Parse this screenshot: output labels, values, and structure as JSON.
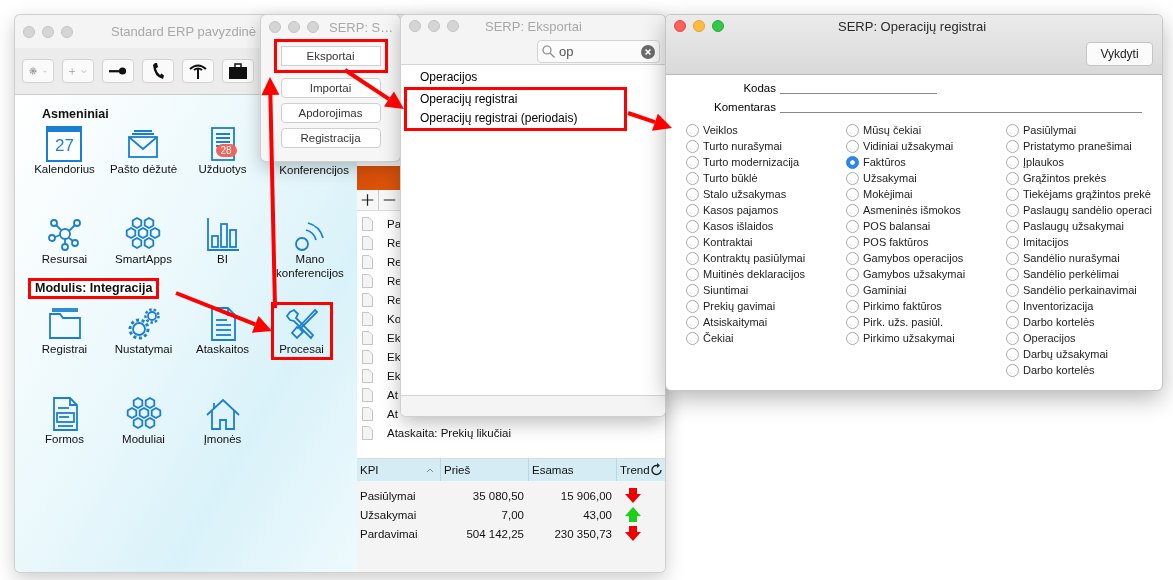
{
  "main_window": {
    "title": "Standard ERP pavyzdinė",
    "active": false,
    "sections": [
      {
        "title": "Asmeniniai",
        "highlighted": false,
        "tiles": [
          {
            "label": "Kalendorius",
            "icon_text": "27",
            "highlighted": false
          },
          {
            "label": "Pašto dėžutė",
            "highlighted": false
          },
          {
            "label": "Užduotys",
            "badge": "28",
            "highlighted": false
          },
          {
            "label": "Konferencijos",
            "highlighted": false
          },
          {
            "label": "Resursai",
            "highlighted": false
          },
          {
            "label": "SmartApps",
            "highlighted": false
          },
          {
            "label": "BI",
            "highlighted": false
          },
          {
            "label": "Mano konferencijos",
            "highlighted": false
          }
        ]
      },
      {
        "title": "Modulis:  Integracija",
        "highlighted": true,
        "tiles": [
          {
            "label": "Registrai",
            "highlighted": false
          },
          {
            "label": "Nustatymai",
            "highlighted": false
          },
          {
            "label": "Ataskaitos",
            "highlighted": false
          },
          {
            "label": "Procesai",
            "highlighted": true
          },
          {
            "label": "Formos",
            "highlighted": false
          },
          {
            "label": "Moduliai",
            "highlighted": false
          },
          {
            "label": "Įmonės",
            "highlighted": false
          }
        ]
      }
    ],
    "list_panel": {
      "items": [
        "Pa",
        "Re",
        "Re",
        "Re",
        "Re",
        "Ko",
        "Ek",
        "Ek",
        "Ek",
        "At",
        "At",
        "Ataskaita: Prekių likučiai"
      ]
    },
    "kpi_table": {
      "columns": [
        "KPI",
        "Prieš",
        "Esamas",
        "Trend"
      ],
      "rows": [
        {
          "name": "Pasiūlymai",
          "before": "35 080,50",
          "current": "15 906,00",
          "trend_up": false
        },
        {
          "name": "Užsakymai",
          "before": "7,00",
          "current": "43,00",
          "trend_up": true
        },
        {
          "name": "Pardavimai",
          "before": "504 142,25",
          "current": "230 350,73",
          "trend_up": false
        }
      ]
    }
  },
  "procedures_window": {
    "title": "SERP: S…",
    "active": false,
    "buttons": [
      {
        "label": "Eksportai",
        "highlighted": true
      },
      {
        "label": "Importai",
        "highlighted": false
      },
      {
        "label": "Apdorojimas",
        "highlighted": false
      },
      {
        "label": "Registracija",
        "highlighted": false
      }
    ]
  },
  "exports_window": {
    "title": "SERP: Eksportai",
    "active": false,
    "search": {
      "value": "op"
    },
    "items": [
      {
        "label": "Operacijos",
        "highlighted": false
      },
      {
        "label": "Operacijų registrai",
        "highlighted": true
      },
      {
        "label": "Operacijų registrai (periodais)",
        "highlighted": true
      }
    ]
  },
  "registers_window": {
    "title": "SERP: Operacijų registrai",
    "active": true,
    "toolbar_button": "Vykdyti",
    "fields": [
      {
        "label": "Kodas"
      },
      {
        "label": "Komentaras"
      }
    ],
    "columns": [
      {
        "options": [
          {
            "label": "Veiklos",
            "selected": false
          },
          {
            "label": "Turto nurašymai",
            "selected": false
          },
          {
            "label": "Turto modernizacija",
            "selected": false
          },
          {
            "label": "Turto būklė",
            "selected": false
          },
          {
            "label": "Stalo užsakymas",
            "selected": false
          },
          {
            "label": "Kasos pajamos",
            "selected": false
          },
          {
            "label": "Kasos išlaidos",
            "selected": false
          },
          {
            "label": "Kontraktai",
            "selected": false
          },
          {
            "label": "Kontraktų pasiūlymai",
            "selected": false
          },
          {
            "label": "Muitinės deklaracijos",
            "selected": false
          },
          {
            "label": "Siuntimai",
            "selected": false
          },
          {
            "label": "Prekių gavimai",
            "selected": false
          },
          {
            "label": "Atsiskaitymai",
            "selected": false
          },
          {
            "label": "Čekiai",
            "selected": false
          }
        ]
      },
      {
        "options": [
          {
            "label": "Mūsų čekiai",
            "selected": false
          },
          {
            "label": "Vidiniai užsakymai",
            "selected": false
          },
          {
            "label": "Faktūros",
            "selected": true
          },
          {
            "label": "Užsakymai",
            "selected": false
          },
          {
            "label": "Mokėjimai",
            "selected": false
          },
          {
            "label": "Asmeninės išmokos",
            "selected": false
          },
          {
            "label": "POS balansai",
            "selected": false
          },
          {
            "label": "POS faktūros",
            "selected": false
          },
          {
            "label": "Gamybos operacijos",
            "selected": false
          },
          {
            "label": "Gamybos užsakymai",
            "selected": false
          },
          {
            "label": "Gaminiai",
            "selected": false
          },
          {
            "label": "Pirkimo faktūros",
            "selected": false
          },
          {
            "label": "Pirk. užs. pasiūl.",
            "selected": false
          },
          {
            "label": "Pirkimo užsakymai",
            "selected": false
          }
        ]
      },
      {
        "options": [
          {
            "label": "Pasiūlymai",
            "selected": false
          },
          {
            "label": "Pristatymo pranešimai",
            "selected": false
          },
          {
            "label": "Įplaukos",
            "selected": false
          },
          {
            "label": "Grąžintos prekės",
            "selected": false
          },
          {
            "label": "Tiekėjams grąžintos prekė",
            "selected": false
          },
          {
            "label": "Paslaugų sandėlio operaci",
            "selected": false
          },
          {
            "label": "Paslaugų užsakymai",
            "selected": false
          },
          {
            "label": "Imitacijos",
            "selected": false
          },
          {
            "label": "Sandėlio nurašymai",
            "selected": false
          },
          {
            "label": "Sandėlio perkėlimai",
            "selected": false
          },
          {
            "label": "Sandėlio perkainavimai",
            "selected": false
          },
          {
            "label": "Inventorizacija",
            "selected": false
          },
          {
            "label": "Darbo kortelės",
            "selected": false
          },
          {
            "label": "Operacijos",
            "selected": false
          },
          {
            "label": "Darbų užsakymai",
            "selected": false
          },
          {
            "label": "Darbo kortelės",
            "selected": false
          }
        ]
      }
    ]
  }
}
